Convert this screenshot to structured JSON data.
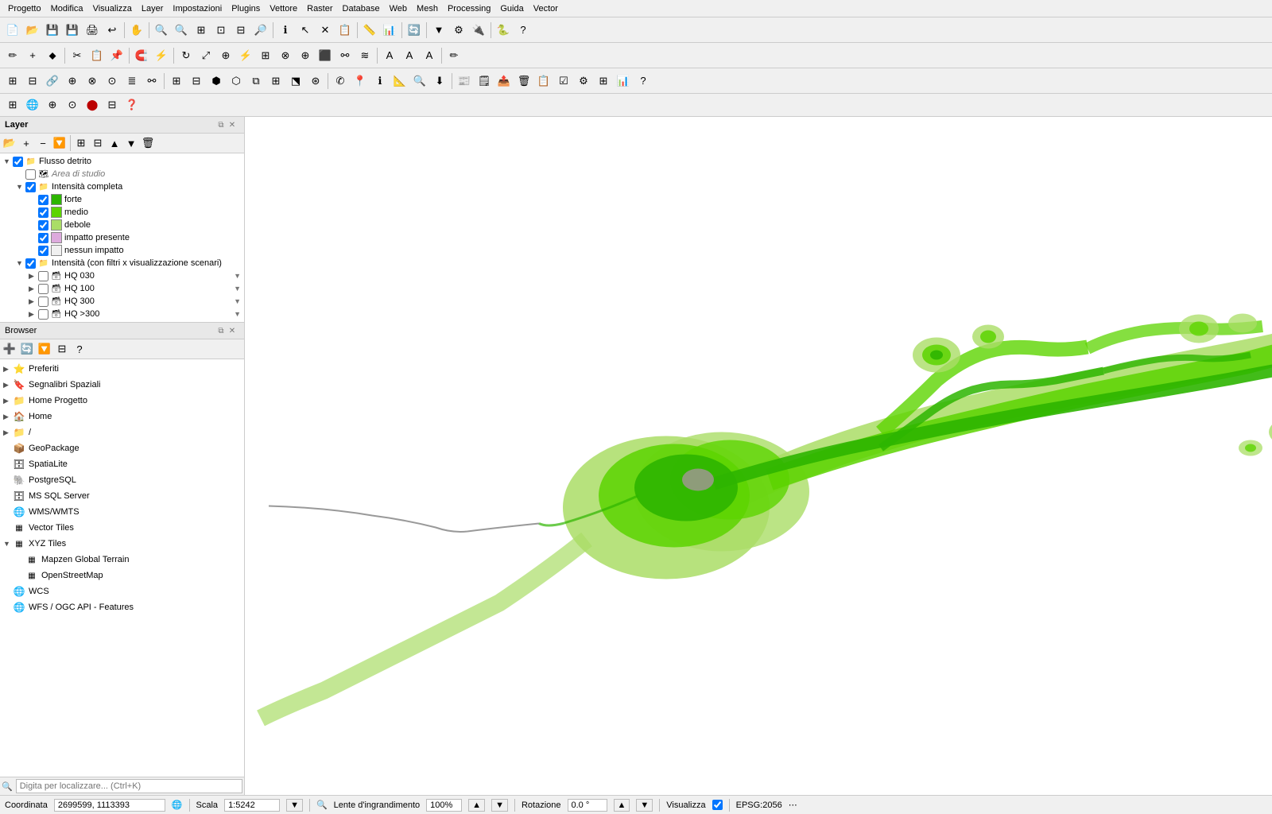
{
  "menubar": {
    "items": [
      "Progetto",
      "Modifica",
      "Visualizza",
      "Layer",
      "Impostazioni",
      "Plugins",
      "Vettore",
      "Raster",
      "Database",
      "Web",
      "Mesh",
      "Processing",
      "Guida",
      "Vector"
    ]
  },
  "layer_panel": {
    "title": "Layer",
    "groups": [
      {
        "name": "Flusso detrito",
        "expanded": true,
        "indent": 0,
        "type": "group",
        "checked": true,
        "children": [
          {
            "name": "Area di studio",
            "indent": 1,
            "type": "raster",
            "checked": false,
            "italic": true
          },
          {
            "name": "Intensità completa",
            "indent": 1,
            "type": "group",
            "checked": true,
            "expanded": true,
            "children": [
              {
                "name": "forte",
                "indent": 2,
                "type": "fill",
                "color": "#2db500",
                "checked": true
              },
              {
                "name": "medio",
                "indent": 2,
                "type": "fill",
                "color": "#5cd400",
                "checked": true
              },
              {
                "name": "debole",
                "indent": 2,
                "type": "fill",
                "color": "#aadd66",
                "checked": true
              },
              {
                "name": "impatto presente",
                "indent": 2,
                "type": "fill",
                "color": "#ddaadd",
                "checked": true
              },
              {
                "name": "nessun impatto",
                "indent": 2,
                "type": "fill",
                "color": "#f0f0f0",
                "checked": true
              }
            ]
          },
          {
            "name": "Intensità (con filtri x visualizzazione scenari)",
            "indent": 1,
            "type": "group",
            "checked": true,
            "expanded": true,
            "children": [
              {
                "name": "HQ 030",
                "indent": 2,
                "type": "filtered",
                "checked": false,
                "has_filter": true
              },
              {
                "name": "HQ 100",
                "indent": 2,
                "type": "filtered",
                "checked": false,
                "has_filter": true
              },
              {
                "name": "HQ 300",
                "indent": 2,
                "type": "filtered",
                "checked": false,
                "has_filter": true
              },
              {
                "name": "HQ >300",
                "indent": 2,
                "type": "filtered",
                "checked": false,
                "has_filter": true
              }
            ]
          }
        ]
      }
    ]
  },
  "browser_panel": {
    "title": "Browser",
    "items": [
      {
        "name": "Preferiti",
        "icon": "⭐",
        "expandable": true,
        "expanded": false
      },
      {
        "name": "Segnalibri Spaziali",
        "icon": "🔖",
        "expandable": true,
        "expanded": false
      },
      {
        "name": "Home Progetto",
        "icon": "📁",
        "expandable": true,
        "expanded": false
      },
      {
        "name": "Home",
        "icon": "🏠",
        "expandable": true,
        "expanded": false
      },
      {
        "name": "/",
        "icon": "📁",
        "expandable": true,
        "expanded": false
      },
      {
        "name": "GeoPackage",
        "icon": "📦",
        "expandable": false,
        "expanded": false
      },
      {
        "name": "SpatiaLite",
        "icon": "🗄",
        "expandable": false,
        "expanded": false
      },
      {
        "name": "PostgreSQL",
        "icon": "🐘",
        "expandable": false,
        "expanded": false
      },
      {
        "name": "MS SQL Server",
        "icon": "🗄",
        "expandable": false,
        "expanded": false
      },
      {
        "name": "WMS/WMTS",
        "icon": "🌐",
        "expandable": false,
        "expanded": false
      },
      {
        "name": "Vector Tiles",
        "icon": "▦",
        "expandable": false,
        "expanded": false
      },
      {
        "name": "XYZ Tiles",
        "icon": "▦",
        "expandable": true,
        "expanded": true,
        "children": [
          {
            "name": "Mapzen Global Terrain",
            "icon": "▦"
          },
          {
            "name": "OpenStreetMap",
            "icon": "▦"
          }
        ]
      },
      {
        "name": "WCS",
        "icon": "🌐",
        "expandable": false,
        "expanded": false
      },
      {
        "name": "WFS / OGC API - Features",
        "icon": "🌐",
        "expandable": false,
        "expanded": false
      }
    ],
    "search_placeholder": "Digita per localizzare... (Ctrl+K)"
  },
  "statusbar": {
    "coordinate_label": "Coordinata",
    "coordinate_value": "2699599, 1113393",
    "scale_label": "Scala",
    "scale_value": "1:5242",
    "lens_label": "Lente d'ingrandimento",
    "lens_value": "100%",
    "rotation_label": "Rotazione",
    "rotation_value": "0.0 °",
    "render_label": "Visualizza",
    "crs_value": "EPSG:2056"
  }
}
